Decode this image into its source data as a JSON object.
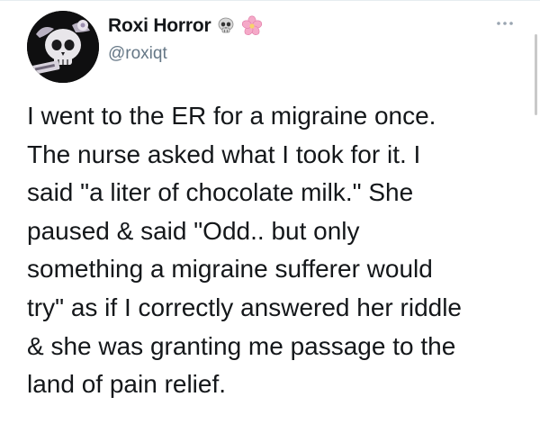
{
  "tweet": {
    "author": {
      "display_name": "Roxi Horror",
      "handle": "@roxiqt",
      "name_emojis": [
        "skull-icon",
        "cherry-blossom-icon"
      ],
      "avatar": "skull-avatar-icon"
    },
    "more_menu": "more-icon",
    "text": "I went to the ER for a migraine once.\nThe nurse asked what I took for it. I\nsaid \"a liter of chocolate milk.\" She\npaused & said \"Odd.. but only\nsomething a migraine sufferer would\ntry\" as if I correctly answered her riddle\n& she was granting me passage to the\nland of pain relief."
  },
  "colors": {
    "text": "#14171a",
    "secondary_text": "#657786",
    "background": "#ffffff",
    "blossom": "#f5a9c8"
  }
}
